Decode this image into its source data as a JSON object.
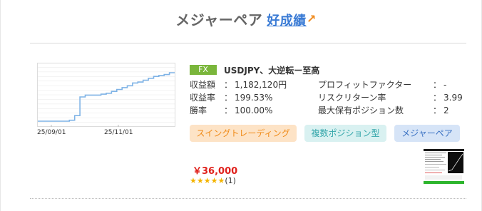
{
  "section": {
    "title": "メジャーペア",
    "badge": "好成績"
  },
  "product": {
    "category_tag": "FX",
    "title": "USDJPY、大逆転ー至高",
    "stats": [
      {
        "label": "収益額",
        "value": "1,182,120円"
      },
      {
        "label": "収益率",
        "value": "199.53%"
      },
      {
        "label": "勝率",
        "value": "100.00%"
      },
      {
        "label": "プロフィットファクター",
        "value": "-"
      },
      {
        "label": "リスクリターン率",
        "value": "3.99"
      },
      {
        "label": "最大保有ポジション数",
        "value": "2"
      }
    ],
    "separator": "：",
    "tags": [
      "スイングトレーディング",
      "複数ポジション型",
      "メジャーペア"
    ],
    "price": "￥36,000",
    "stars": "★★★★★",
    "review_count": "(1)"
  },
  "chart_data": {
    "type": "line",
    "x_tick_labels": [
      "25/09/01",
      "25/11/01"
    ],
    "values": [
      0,
      0,
      0,
      0,
      0,
      0,
      0.5,
      3,
      13,
      14,
      14,
      14,
      14.5,
      15,
      16,
      17,
      18,
      19,
      20.5,
      21,
      22,
      23,
      24,
      24.5,
      25,
      26,
      26
    ],
    "grid": true,
    "color": "#7fb3e6"
  }
}
